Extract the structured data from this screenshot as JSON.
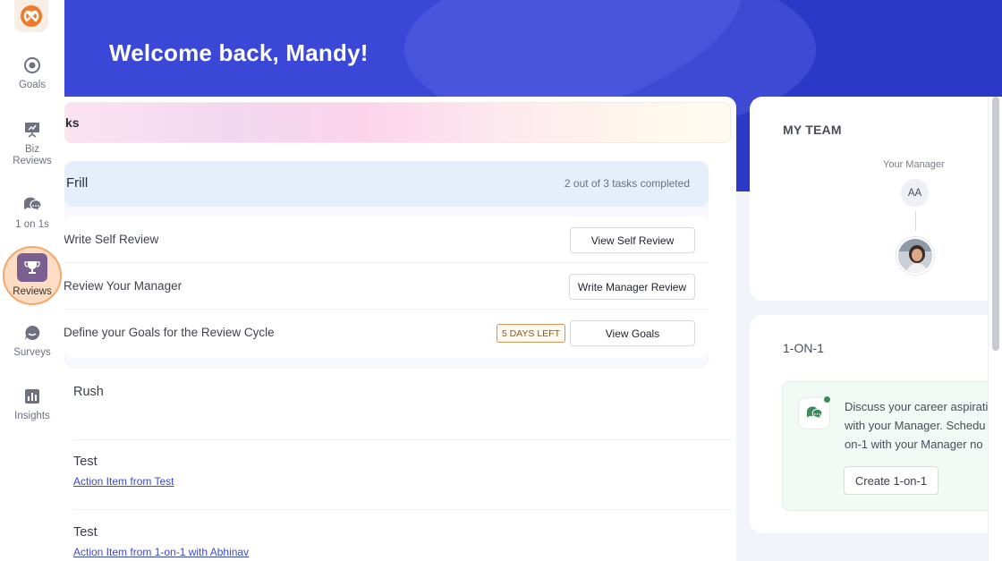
{
  "hero": {
    "welcome": "Welcome back, Mandy!"
  },
  "sidebar": {
    "items": [
      {
        "label": "Goals",
        "icon": "target-icon"
      },
      {
        "label": "Biz\nReviews",
        "icon": "presentation-icon"
      },
      {
        "label": "1 on 1s",
        "icon": "chat-bubbles-icon"
      },
      {
        "label": "Reviews",
        "icon": "trophy-icon",
        "active": true
      },
      {
        "label": "Surveys",
        "icon": "survey-bubble-icon"
      },
      {
        "label": "Insights",
        "icon": "bar-chart-icon"
      }
    ],
    "colors": {
      "active_bg": "#7c5f91",
      "active_ring": "#f6a76a",
      "logo": "#f07a2a"
    }
  },
  "main": {
    "gradient_title": "ks",
    "review": {
      "name": "Frill",
      "progress": "2 out of 3 tasks completed",
      "tasks": [
        {
          "title": "Write Self Review",
          "button": "View Self Review"
        },
        {
          "title": "Review Your Manager",
          "button": "Write Manager Review"
        },
        {
          "title": "Define your Goals for the Review Cycle",
          "badge": "5 DAYS LEFT",
          "button": "View Goals"
        }
      ]
    },
    "items": [
      {
        "title": "Rush",
        "link": ""
      },
      {
        "title": "Test",
        "link": "Action Item from Test"
      },
      {
        "title": "Test",
        "link": "Action Item from 1-on-1 with Abhinav"
      }
    ]
  },
  "team": {
    "title": "MY TEAM",
    "manager_label": "Your Manager",
    "manager_initials": "AA",
    "avatar": "user-photo-avatar"
  },
  "one_on_one": {
    "title": "1-ON-1",
    "lines": [
      "Discuss your career aspirati",
      "with your Manager. Schedu",
      "on-1 with your Manager no"
    ],
    "button": "Create 1-on-1",
    "accent": "#3b8a5d"
  },
  "theme": {
    "hero_bg": "#2b38c8",
    "link": "#3b4bc9",
    "badge_border": "#c9975e"
  }
}
